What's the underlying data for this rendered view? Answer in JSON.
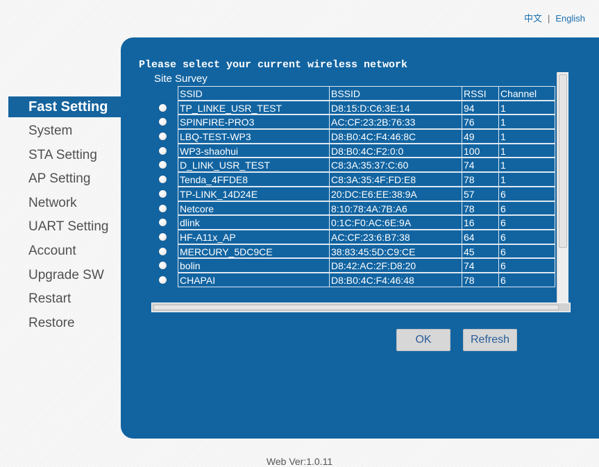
{
  "lang": {
    "chinese": "中文",
    "separator": "|",
    "english": "English"
  },
  "nav": [
    {
      "label": "Fast Setting",
      "active": true
    },
    {
      "label": "System"
    },
    {
      "label": "STA Setting"
    },
    {
      "label": "AP Setting"
    },
    {
      "label": "Network"
    },
    {
      "label": "UART Setting"
    },
    {
      "label": "Account"
    },
    {
      "label": "Upgrade SW"
    },
    {
      "label": "Restart"
    },
    {
      "label": "Restore"
    }
  ],
  "panel": {
    "prompt": "Please select your current wireless network",
    "survey_title": "Site Survey",
    "columns": [
      "SSID",
      "BSSID",
      "RSSI",
      "Channel"
    ],
    "networks": [
      {
        "ssid": "TP_LINKE_USR_TEST",
        "bssid": "D8:15:D:C6:3E:14",
        "rssi": "94",
        "channel": "1"
      },
      {
        "ssid": "SPINFIRE-PRO3",
        "bssid": "AC:CF:23:2B:76:33",
        "rssi": "76",
        "channel": "1"
      },
      {
        "ssid": "LBQ-TEST-WP3",
        "bssid": "D8:B0:4C:F4:46:8C",
        "rssi": "49",
        "channel": "1"
      },
      {
        "ssid": "WP3-shaohui",
        "bssid": "D8:B0:4C:F2:0:0",
        "rssi": "100",
        "channel": "1"
      },
      {
        "ssid": "D_LINK_USR_TEST",
        "bssid": "C8:3A:35:37:C:60",
        "rssi": "74",
        "channel": "1"
      },
      {
        "ssid": "Tenda_4FFDE8",
        "bssid": "C8:3A:35:4F:FD:E8",
        "rssi": "78",
        "channel": "1"
      },
      {
        "ssid": "TP-LINK_14D24E",
        "bssid": "20:DC:E6:EE:38:9A",
        "rssi": "57",
        "channel": "6"
      },
      {
        "ssid": "Netcore",
        "bssid": "8:10:78:4A:7B:A6",
        "rssi": "78",
        "channel": "6"
      },
      {
        "ssid": "dlink",
        "bssid": "0:1C:F0:AC:6E:9A",
        "rssi": "16",
        "channel": "6"
      },
      {
        "ssid": "HF-A11x_AP",
        "bssid": "AC:CF:23:6:B7:38",
        "rssi": "64",
        "channel": "6"
      },
      {
        "ssid": "MERCURY_5DC9CE",
        "bssid": "38:83:45:5D:C9:CE",
        "rssi": "45",
        "channel": "6"
      },
      {
        "ssid": "bolin",
        "bssid": "D8:42:AC:2F:D8:20",
        "rssi": "74",
        "channel": "6"
      },
      {
        "ssid": "CHAPAI",
        "bssid": "D8:B0:4C:F4:46:48",
        "rssi": "78",
        "channel": "6"
      }
    ],
    "ok_label": "OK",
    "refresh_label": "Refresh"
  },
  "footer": "Web Ver:1.0.11"
}
